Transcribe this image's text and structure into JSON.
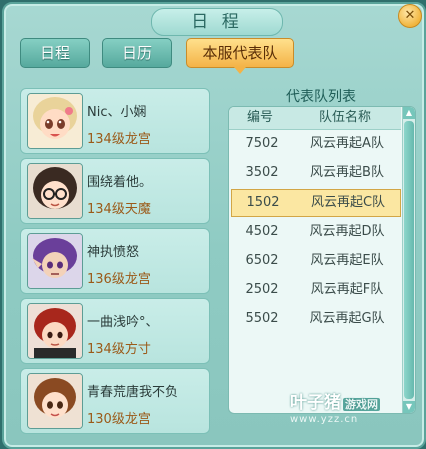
{
  "window": {
    "title": "日 程",
    "close_glyph": "✕"
  },
  "tabs": [
    {
      "label": "日程",
      "active": false
    },
    {
      "label": "日历",
      "active": false
    },
    {
      "label": "本服代表队",
      "active": true
    }
  ],
  "players": [
    {
      "name": "Nic、小娴",
      "level": "134级龙宫",
      "avatar": "girl-blonde-avatar"
    },
    {
      "name": "围绕着他。",
      "level": "134级天魔",
      "avatar": "girl-glasses-avatar"
    },
    {
      "name": "神执愤怒",
      "level": "136级龙宫",
      "avatar": "purple-hair-avatar"
    },
    {
      "name": "一曲浅吟°、",
      "level": "134级方寸",
      "avatar": "red-hair-avatar"
    },
    {
      "name": "青春荒唐我不负",
      "level": "130级龙宫",
      "avatar": "brown-hair-girl-avatar"
    }
  ],
  "team_list": {
    "title": "代表队列表",
    "headers": {
      "number": "编号",
      "name": "队伍名称"
    },
    "rows": [
      {
        "number": "7502",
        "name": "风云再起A队",
        "selected": false
      },
      {
        "number": "3502",
        "name": "风云再起B队",
        "selected": false
      },
      {
        "number": "1502",
        "name": "风云再起C队",
        "selected": true
      },
      {
        "number": "4502",
        "name": "风云再起D队",
        "selected": false
      },
      {
        "number": "6502",
        "name": "风云再起E队",
        "selected": false
      },
      {
        "number": "2502",
        "name": "风云再起F队",
        "selected": false
      },
      {
        "number": "5502",
        "name": "风云再起G队",
        "selected": false
      }
    ]
  },
  "watermark": {
    "brand": "叶子猪",
    "tag": "游戏网",
    "url": "www.yzz.cn"
  },
  "colors": {
    "accent": "#f4b347",
    "panel": "#8fcbc3",
    "selected_row": "#fbe7a2"
  }
}
